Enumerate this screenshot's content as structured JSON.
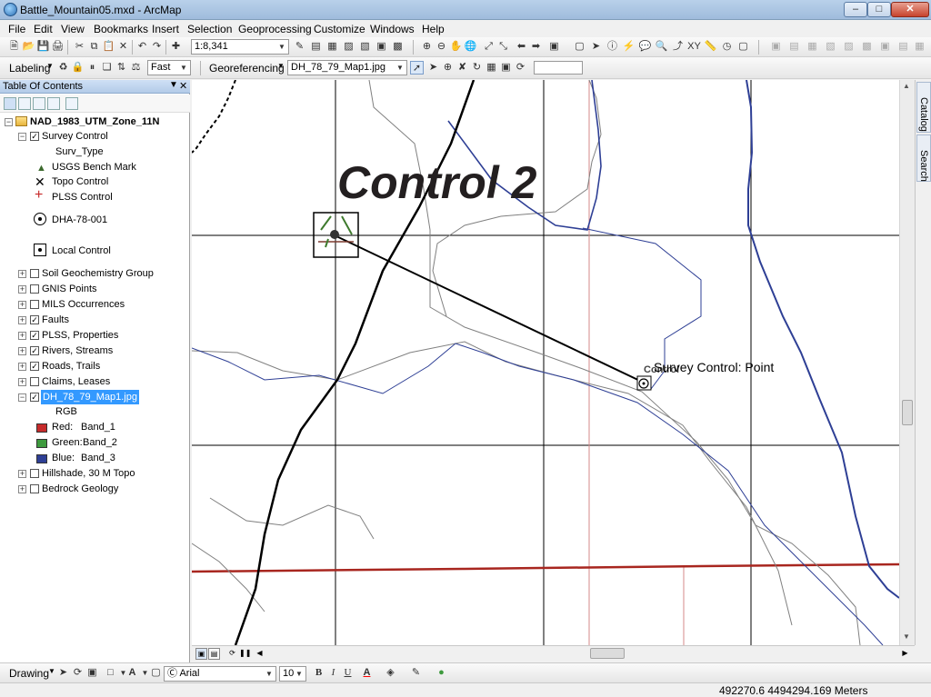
{
  "window": {
    "title": "Battle_Mountain05.mxd - ArcMap"
  },
  "menu": [
    "File",
    "Edit",
    "View",
    "Bookmarks",
    "Insert",
    "Selection",
    "Geoprocessing",
    "Customize",
    "Windows",
    "Help"
  ],
  "standard_toolbar": {
    "scale": "1:8,341"
  },
  "labeling_toolbar": {
    "label": "Labeling",
    "quality": "Fast"
  },
  "georef_toolbar": {
    "label": "Georeferencing",
    "layer": "DH_78_79_Map1.jpg",
    "value": ""
  },
  "toc": {
    "title": "Table Of Contents",
    "frame": "NAD_1983_UTM_Zone_11N",
    "survey_group": "Survey Control",
    "field": "Surv_Type",
    "symbols": [
      "USGS Bench Mark",
      "Topo Control",
      "PLSS Control",
      "DHA-78-001",
      "Local Control"
    ],
    "layers": [
      {
        "name": "Soil Geochemistry Group",
        "checked": false,
        "expand": "+"
      },
      {
        "name": "GNIS Points",
        "checked": false,
        "expand": "+"
      },
      {
        "name": "MILS Occurrences",
        "checked": false,
        "expand": "+"
      },
      {
        "name": "Faults",
        "checked": true,
        "expand": "+"
      },
      {
        "name": "PLSS, Properties",
        "checked": true,
        "expand": "+"
      },
      {
        "name": "Rivers, Streams",
        "checked": true,
        "expand": "+"
      },
      {
        "name": "Roads, Trails",
        "checked": true,
        "expand": "+"
      },
      {
        "name": "Claims, Leases",
        "checked": false,
        "expand": "+"
      },
      {
        "name": "DH_78_79_Map1.jpg",
        "checked": true,
        "expand": "−",
        "selected": true
      }
    ],
    "raster_render": "RGB",
    "bands": [
      {
        "label": "Red:",
        "band": "Band_1",
        "color": "#c62b2b"
      },
      {
        "label": "Green:",
        "band": "Band_2",
        "color": "#3e9a3e"
      },
      {
        "label": "Blue:",
        "band": "Band_3",
        "color": "#2e3f95"
      }
    ],
    "layers_after": [
      {
        "name": "Hillshade, 30 M Topo",
        "checked": false,
        "expand": "+"
      },
      {
        "name": "Bedrock Geology",
        "checked": false,
        "expand": "+"
      }
    ]
  },
  "map": {
    "annotation": "Control 2",
    "point_label": "Survey Control: Point",
    "ghost_label": "Control"
  },
  "dock_tabs": [
    "Catalog",
    "Search"
  ],
  "drawing_toolbar": {
    "label": "Drawing",
    "font": "Arial",
    "size": "10",
    "bold": "B",
    "italic": "I",
    "underline": "U",
    "text_tool": "A"
  },
  "status": {
    "coords": "492270.6  4494294.169 Meters"
  }
}
